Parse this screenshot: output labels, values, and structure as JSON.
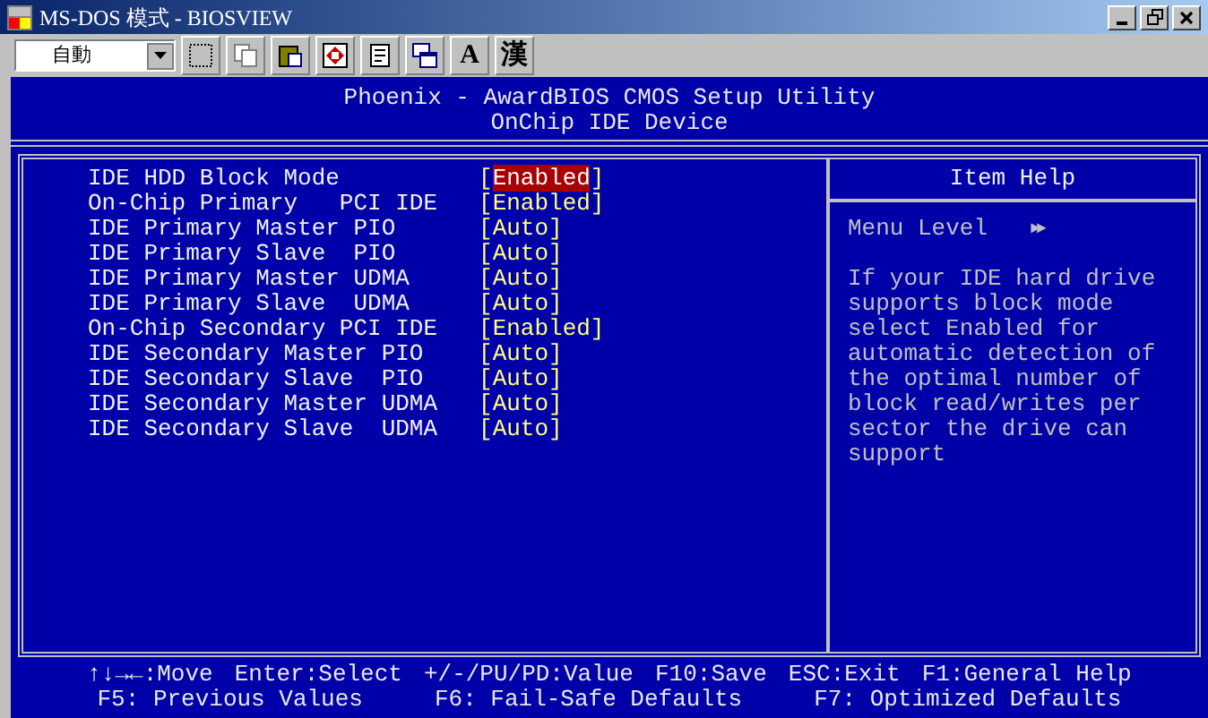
{
  "window": {
    "title": "MS-DOS 模式 - BIOSVIEW"
  },
  "toolbar": {
    "font_size": "自動",
    "text_buttons": [
      "A",
      "漢"
    ]
  },
  "header": {
    "title": "Phoenix - AwardBIOS CMOS Setup Utility",
    "subtitle": "OnChip IDE Device"
  },
  "settings": [
    {
      "label": "IDE HDD Block Mode",
      "value": "[Enabled]",
      "selected": true
    },
    {
      "label": "On-Chip Primary   PCI IDE",
      "value": "[Enabled]",
      "selected": false
    },
    {
      "label": "IDE Primary Master PIO",
      "value": "[Auto]",
      "selected": false
    },
    {
      "label": "IDE Primary Slave  PIO",
      "value": "[Auto]",
      "selected": false
    },
    {
      "label": "IDE Primary Master UDMA",
      "value": "[Auto]",
      "selected": false
    },
    {
      "label": "IDE Primary Slave  UDMA",
      "value": "[Auto]",
      "selected": false
    },
    {
      "label": "On-Chip Secondary PCI IDE",
      "value": "[Enabled]",
      "selected": false
    },
    {
      "label": "IDE Secondary Master PIO",
      "value": "[Auto]",
      "selected": false
    },
    {
      "label": "IDE Secondary Slave  PIO",
      "value": "[Auto]",
      "selected": false
    },
    {
      "label": "IDE Secondary Master UDMA",
      "value": "[Auto]",
      "selected": false
    },
    {
      "label": "IDE Secondary Slave  UDMA",
      "value": "[Auto]",
      "selected": false
    }
  ],
  "help": {
    "title": "Item Help",
    "menu_level": "Menu Level",
    "menu_level_marker": "►►",
    "text": "If your IDE hard drive supports block mode select Enabled for automatic detection of the optimal number of block read/writes per sector the drive can support"
  },
  "footer": [
    [
      "↑↓→←:Move",
      "Enter:Select",
      "+/-/PU/PD:Value",
      "F10:Save",
      "ESC:Exit",
      "F1:General Help"
    ],
    [
      "F5: Previous Values",
      "F6: Fail-Safe Defaults",
      "F7: Optimized Defaults"
    ]
  ]
}
